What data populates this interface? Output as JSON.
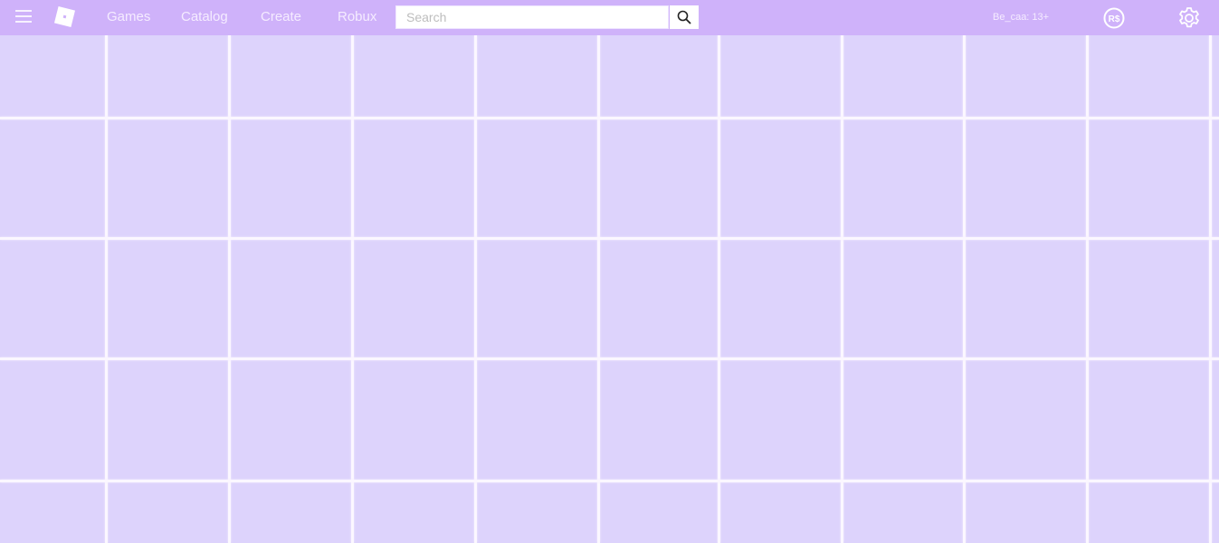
{
  "header": {
    "menu_icon": "hamburger-menu-icon",
    "logo_icon": "roblox-logo-icon",
    "nav": [
      {
        "label": "Games"
      },
      {
        "label": "Catalog"
      },
      {
        "label": "Create"
      },
      {
        "label": "Robux"
      }
    ],
    "search": {
      "placeholder": "Search",
      "value": "",
      "button_icon": "search-icon"
    },
    "username": "Be_caa: 13+",
    "robux_icon": "robux-icon",
    "settings_icon": "gear-icon"
  },
  "colors": {
    "topbar": "#cfb2fa",
    "background": "#ddd3fc",
    "grid_line": "#fbf7ff",
    "text": "#f5ecff"
  },
  "background": {
    "pattern": "grid",
    "columns": 10,
    "rows": 5
  }
}
